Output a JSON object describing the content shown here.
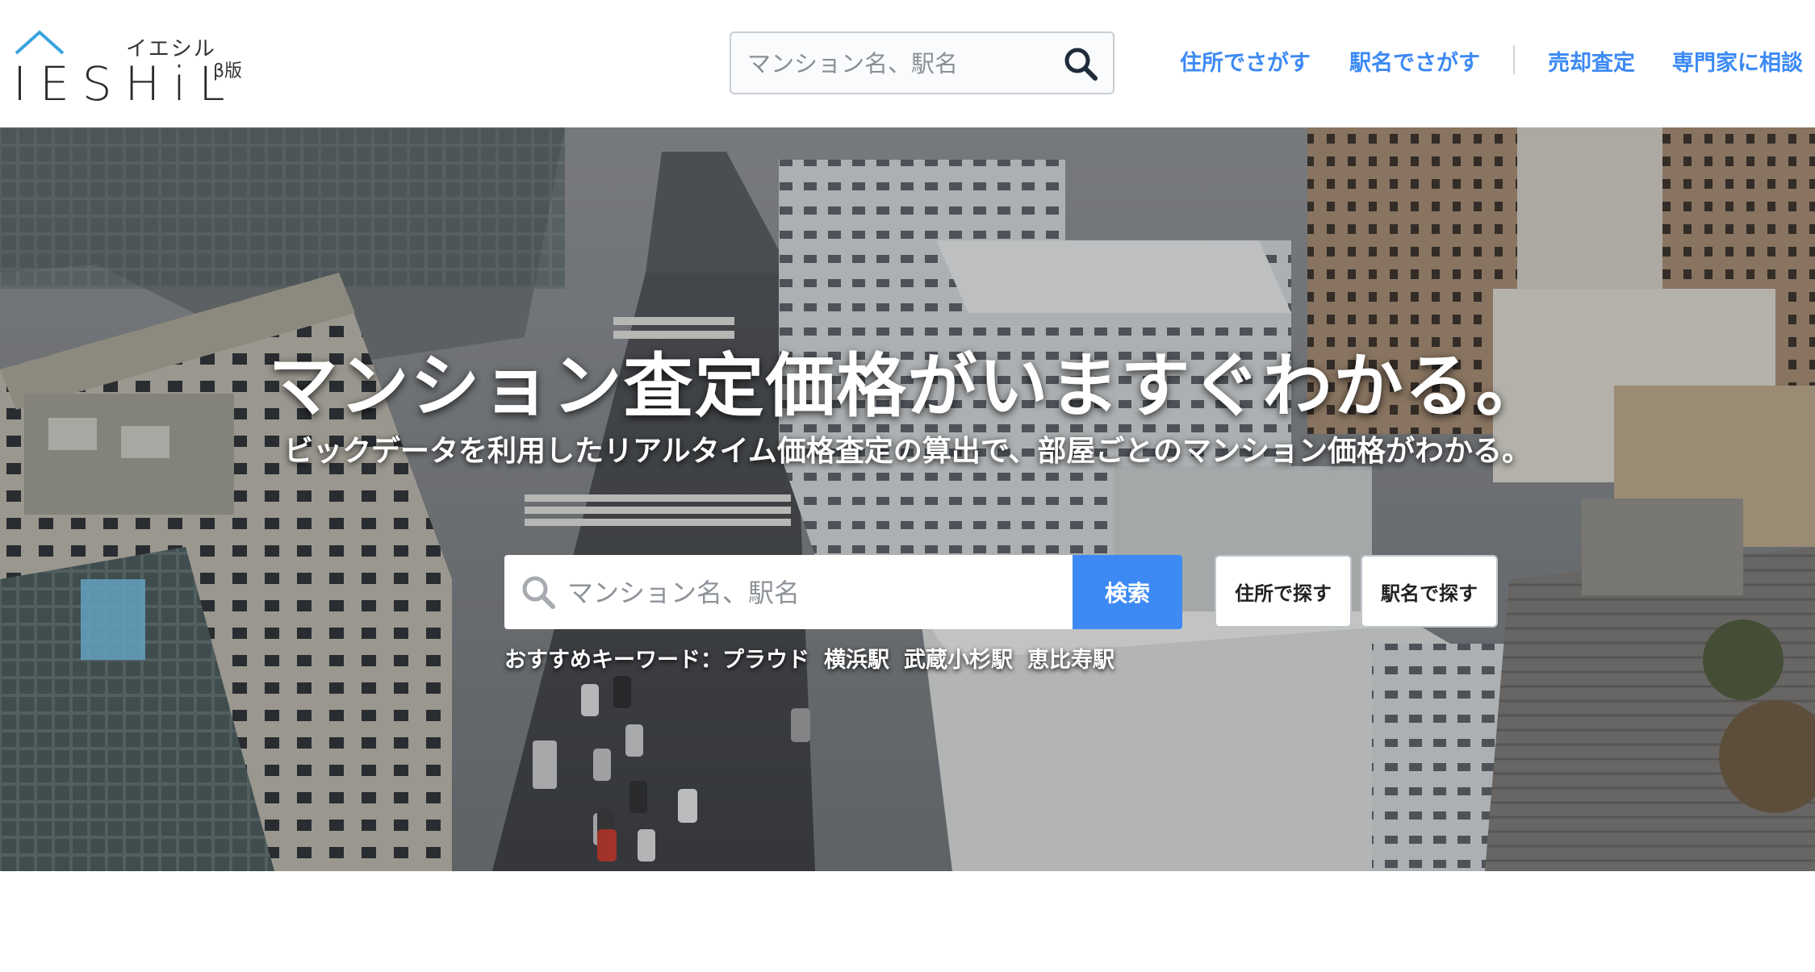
{
  "header": {
    "logo": {
      "kana": "イエシル",
      "wordmark": "IESHiL",
      "beta": "β版"
    },
    "search": {
      "placeholder": "マンション名、駅名"
    },
    "nav": [
      "住所でさがす",
      "駅名でさがす",
      "売却査定",
      "専門家に相談"
    ]
  },
  "hero": {
    "headline": "マンション査定価格がいますぐわかる。",
    "subline": "ビックデータを利用したリアルタイム価格査定の算出で、部屋ごとのマンション価格がわかる。",
    "search": {
      "placeholder": "マンション名、駅名",
      "button": "検索"
    },
    "alt_buttons": [
      "住所で探す",
      "駅名で探す"
    ],
    "keywords": {
      "label": "おすすめキーワード：",
      "items": [
        "プラウド",
        "横浜駅",
        "武蔵小杉駅",
        "恵比寿駅"
      ]
    }
  },
  "colors": {
    "accent": "#3d8af5",
    "logo_roof": "#3aa3e0"
  },
  "icons": [
    "house-roof-icon",
    "search-icon"
  ]
}
